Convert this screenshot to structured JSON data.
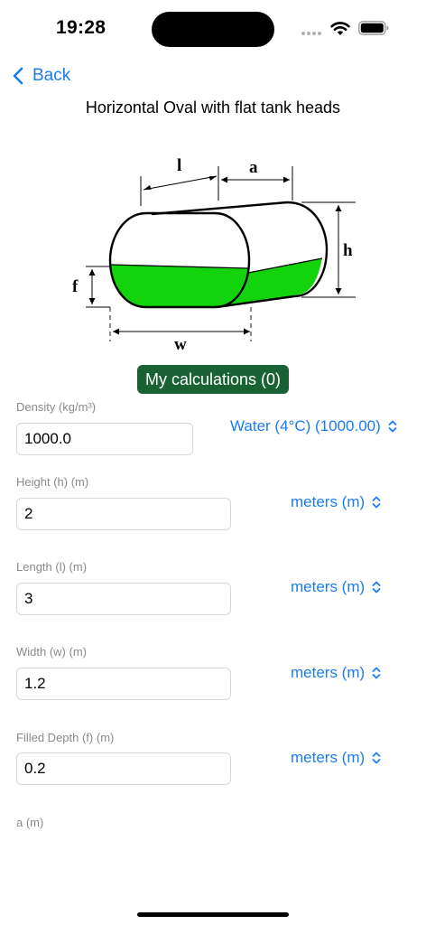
{
  "status": {
    "time": "19:28"
  },
  "nav": {
    "back_label": "Back",
    "title": "Horizontal Oval with flat tank heads"
  },
  "diagram": {
    "labels": {
      "l": "l",
      "a": "a",
      "h": "h",
      "f": "f",
      "w": "w"
    },
    "fill_color": "#13d30d"
  },
  "calc_button": {
    "label": "My calculations (0)"
  },
  "fields": {
    "density": {
      "label": "Density (kg/m³)",
      "value": "1000.0",
      "unit": "Water (4°C) (1000.00)"
    },
    "height": {
      "label": "Height (h) (m)",
      "value": "2",
      "unit": "meters (m)"
    },
    "length": {
      "label": "Length (l) (m)",
      "value": "3",
      "unit": "meters (m)"
    },
    "width": {
      "label": "Width (w) (m)",
      "value": "1.2",
      "unit": "meters (m)"
    },
    "filled_depth": {
      "label": "Filled Depth (f) (m)",
      "value": "0.2",
      "unit": "meters (m)"
    },
    "a": {
      "label": "a (m)"
    }
  },
  "colors": {
    "accent": "#1a7cf5",
    "button_bg": "#1a6134",
    "label_gray": "#8a8a8e"
  },
  "icons": [
    "wifi-icon",
    "battery-icon",
    "chevron-left-icon",
    "chevron-updown-icon"
  ]
}
